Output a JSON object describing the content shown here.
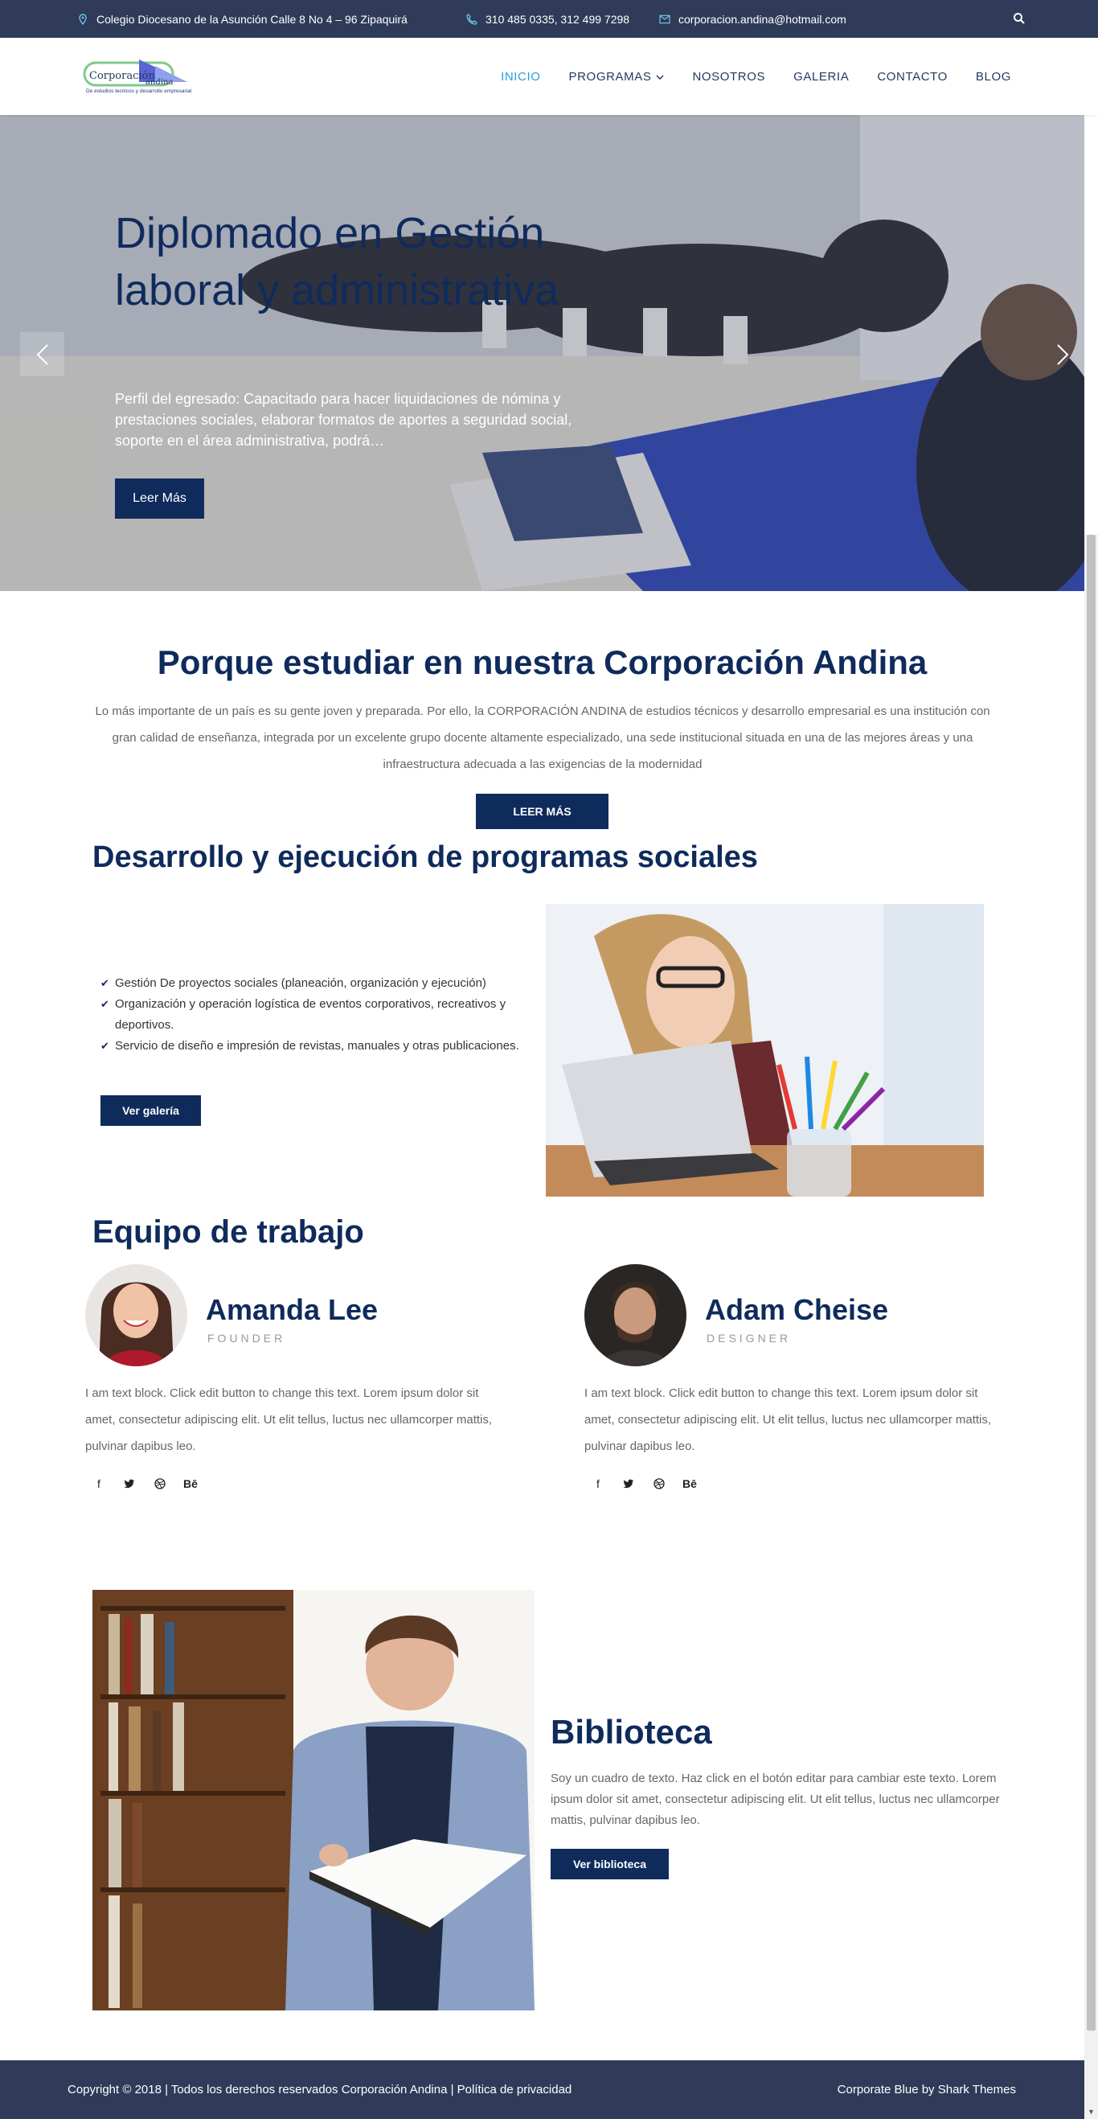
{
  "topbar": {
    "address": "Colegio Diocesano de la Asunción Calle 8 No 4 – 96 Zipaquirá",
    "phone": "310 485 0335, 312 499 7298",
    "email": "corporacion.andina@hotmail.com"
  },
  "logo": {
    "name_line1": "Corporación",
    "name_line2": "andina",
    "tagline": "De estudios tecnicos y desarrollo empresarial"
  },
  "nav": {
    "items": [
      "INICIO",
      "PROGRAMAS",
      "NOSOTROS",
      "GALERIA",
      "CONTACTO",
      "BLOG"
    ],
    "active": "INICIO"
  },
  "hero": {
    "title": "Diplomado en Gestión laboral y administrativa",
    "text": "Perfil del egresado: Capacitado para hacer liquidaciones de nómina y prestaciones sociales, elaborar formatos de aportes a seguridad social, soporte en el área administrativa, podrá…",
    "button": "Leer Más"
  },
  "porque": {
    "title": "Porque estudiar en nuestra Corporación Andina",
    "text": "Lo más importante de un país es su gente joven y preparada. Por ello, la CORPORACIÓN ANDINA de estudios técnicos y desarrollo empresarial es una institución con gran calidad de enseñanza, integrada por un excelente grupo docente altamente especializado, una sede institucional situada en una de las mejores áreas y una infraestructura adecuada a las exigencias de la modernidad",
    "button": "LEER MÁS"
  },
  "programas": {
    "title": "Desarrollo y ejecución de programas sociales",
    "items": [
      "Gestión De proyectos sociales (planeación, organización y ejecución)",
      "Organización y operación logística de eventos corporativos, recreativos y deportivos.",
      "Servicio de diseño e impresión de revistas, manuales y otras publicaciones."
    ],
    "button": "Ver galería"
  },
  "equipo": {
    "title": "Equipo de trabajo",
    "members": [
      {
        "name": "Amanda Lee",
        "role": "FOUNDER",
        "bio": "I am text block. Click edit button to change this text. Lorem ipsum dolor sit amet, consectetur adipiscing elit. Ut elit tellus, luctus nec ullamcorper mattis, pulvinar dapibus leo."
      },
      {
        "name": "Adam Cheise",
        "role": "DESIGNER",
        "bio": "I am text block. Click edit button to change this text. Lorem ipsum dolor sit amet, consectetur adipiscing elit. Ut elit tellus, luctus nec ullamcorper mattis, pulvinar dapibus leo."
      }
    ],
    "social_icons": [
      "facebook-icon",
      "twitter-icon",
      "dribbble-icon",
      "behance-icon"
    ]
  },
  "biblioteca": {
    "title": "Biblioteca",
    "text": "Soy un cuadro de texto. Haz click en el botón editar para cambiar este texto. Lorem ipsum dolor sit amet, consectetur adipiscing elit. Ut elit tellus, luctus nec ullamcorper mattis, pulvinar dapibus leo.",
    "button": "Ver biblioteca"
  },
  "footer": {
    "copyright": "Copyright © 2018 | Todos los derechos reservados Corporación Andina | Política de privacidad",
    "credit": "Corporate Blue by Shark Themes"
  },
  "colors": {
    "navy": "#0f2b5c",
    "topbar": "#2f3b59",
    "accent": "#2a9fd8"
  }
}
